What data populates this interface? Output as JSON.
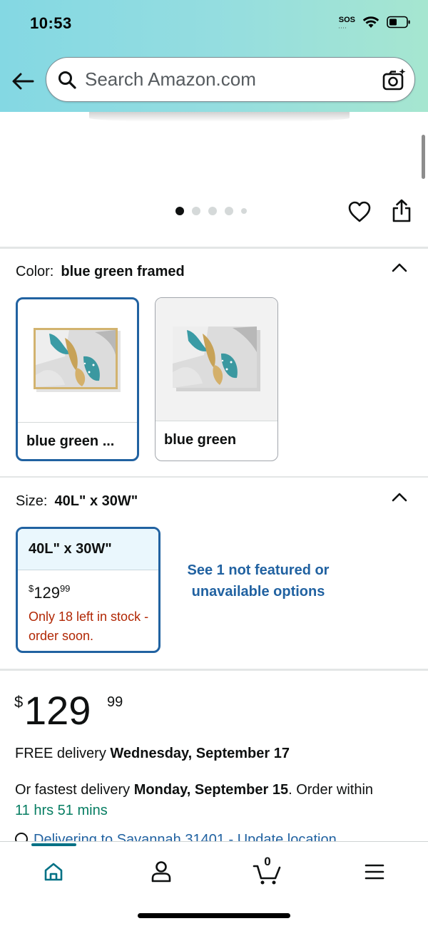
{
  "status_bar": {
    "time": "10:53",
    "sos": "SOS"
  },
  "search": {
    "placeholder": "Search Amazon.com"
  },
  "gallery": {
    "dot_count": 5,
    "active_index": 0
  },
  "color": {
    "label": "Color:",
    "selected_value": "blue green framed",
    "options": [
      {
        "label": "blue green ...",
        "selected": true
      },
      {
        "label": "blue green",
        "selected": false
      }
    ]
  },
  "size": {
    "label": "Size:",
    "selected_value": "40L\" x 30W\"",
    "option": {
      "label": "40L\" x 30W\"",
      "price_symbol": "$",
      "price_whole": "129",
      "price_fraction": "99",
      "stock_note": "Only 18 left in stock - order soon."
    },
    "see_more": "See 1 not featured or unavailable options"
  },
  "price": {
    "symbol": "$",
    "whole": "129",
    "fraction": "99"
  },
  "delivery": {
    "free_prefix": "FREE delivery ",
    "free_date": "Wednesday, September 17",
    "fast_prefix": "Or fastest delivery ",
    "fast_date": "Monday, September 15",
    "fast_suffix": ". Order within ",
    "countdown": "11 hrs 51 mins",
    "deliver_to": "Delivering to Savannah 31401 - Update location"
  },
  "bottom_nav": {
    "cart_count": "0"
  },
  "colors": {
    "accent_blue": "#2162a1",
    "teal": "#007185",
    "stock_red": "#b12704",
    "green": "#067d62"
  }
}
